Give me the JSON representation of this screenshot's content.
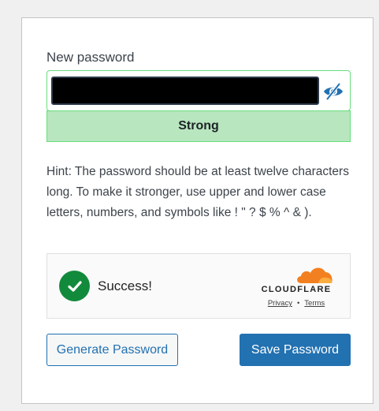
{
  "form": {
    "label": "New password",
    "password_value": "",
    "strength": "Strong",
    "hint": "Hint: The password should be at least twelve characters long. To make it stronger, use upper and lower case letters, numbers, and symbols like ! \" ? $ % ^ & ).",
    "toggle_icon": "eye-slash-icon"
  },
  "captcha": {
    "status": "Success!",
    "brand": "CLOUDFLARE",
    "privacy": "Privacy",
    "separator": "•",
    "terms": "Terms"
  },
  "buttons": {
    "generate": "Generate Password",
    "save": "Save Password"
  },
  "colors": {
    "primary": "#2271b1",
    "strength_bg": "#b8e6bf",
    "strength_border": "#68de7c",
    "success": "#128a3b",
    "cloudflare_orange": "#f38020"
  }
}
